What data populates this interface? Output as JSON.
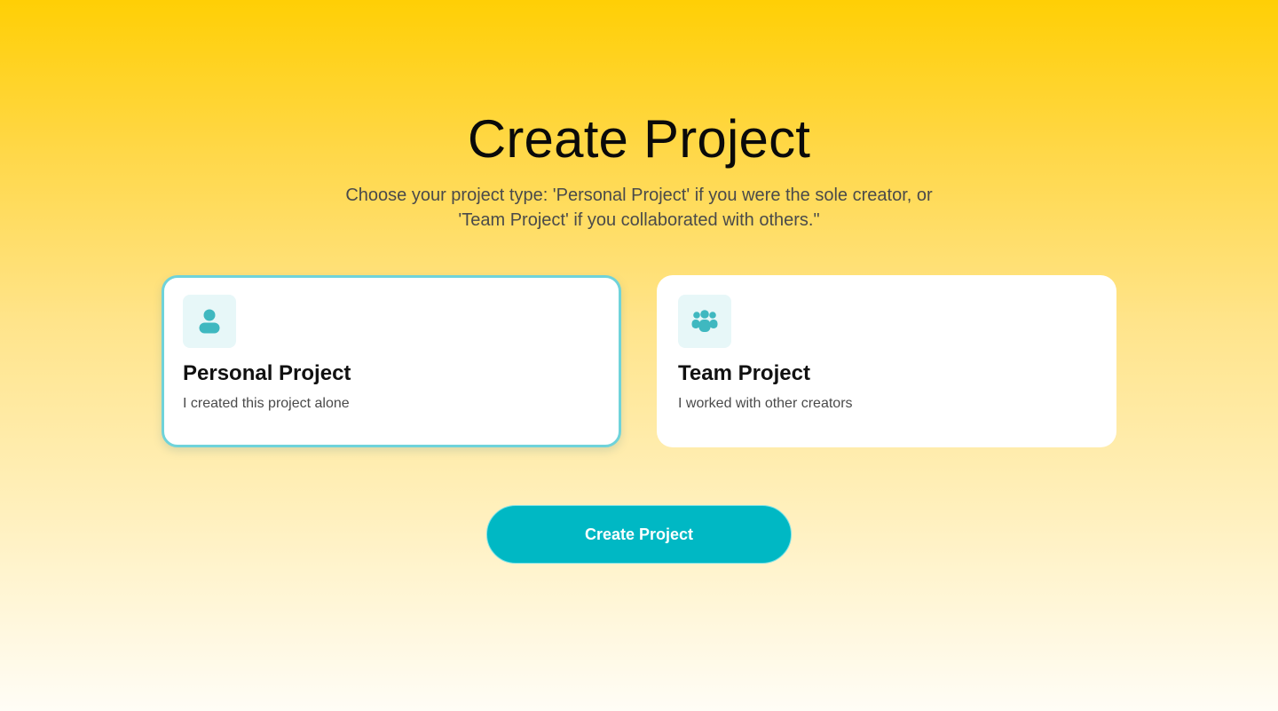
{
  "page": {
    "title": "Create Project",
    "subtitle": "Choose your project type: 'Personal Project' if you were the sole creator, or 'Team Project' if you collaborated with others.\""
  },
  "options": [
    {
      "title": "Personal Project",
      "description": "I created this project alone",
      "icon": "user-icon",
      "selected": true
    },
    {
      "title": "Team Project",
      "description": "I worked with other creators",
      "icon": "users-icon",
      "selected": false
    }
  ],
  "actions": {
    "create_label": "Create Project"
  },
  "colors": {
    "accent": "#00b8c4",
    "selected_border": "#6fd3da",
    "icon_bg": "#e7f7f8",
    "icon_fg": "#3fb8c0",
    "background_top": "#ffcf05",
    "background_bottom": "#fffdf6"
  }
}
